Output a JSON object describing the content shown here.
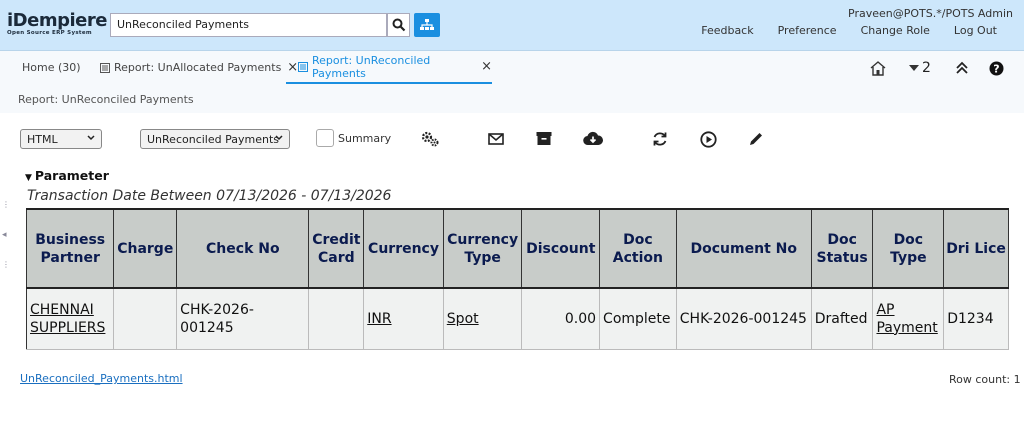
{
  "header": {
    "logo_main": "iDempiere",
    "logo_sub": "Open Source ERP System",
    "search_value": "UnReconciled Payments",
    "user": "Praveen@POTS.*/POTS Admin",
    "links": [
      "Feedback",
      "Preference",
      "Change Role",
      "Log Out"
    ]
  },
  "tabs": [
    {
      "label": "Home (30)"
    },
    {
      "label": "Report: UnAllocated Payments"
    },
    {
      "label": "Report: UnReconciled Payments"
    }
  ],
  "tab_tools": {
    "window_count": "2"
  },
  "breadcrumb": "Report: UnReconciled Payments",
  "toolbar": {
    "format_select": "HTML",
    "report_select": "UnReconciled Payments",
    "summary_label": "Summary"
  },
  "parameter": {
    "title": "Parameter",
    "text": "Transaction Date Between 07/13/2026 - 07/13/2026"
  },
  "table": {
    "columns": [
      "Business Partner",
      "Charge",
      "Check No",
      "Credit Card",
      "Currency",
      "Currency Type",
      "Discount",
      "Doc Action",
      "Document No",
      "Doc Status",
      "Doc Type",
      "Dri Lice"
    ],
    "rows": [
      [
        "CHENNAI SUPPLIERS",
        "",
        "CHK-2026-001245",
        "",
        "INR",
        "Spot",
        "0.00",
        "Complete",
        "CHK-2026-001245",
        "Drafted",
        "AP Payment",
        "D1234"
      ]
    ]
  },
  "footer": {
    "file_link": "UnReconciled_Payments.html",
    "row_count": "Row count: 1"
  },
  "colors": {
    "header_bg": "#cde7fb",
    "accent": "#1a8fe0",
    "table_header_bg": "#c8ccc9",
    "table_header_text": "#0b1b4f"
  }
}
